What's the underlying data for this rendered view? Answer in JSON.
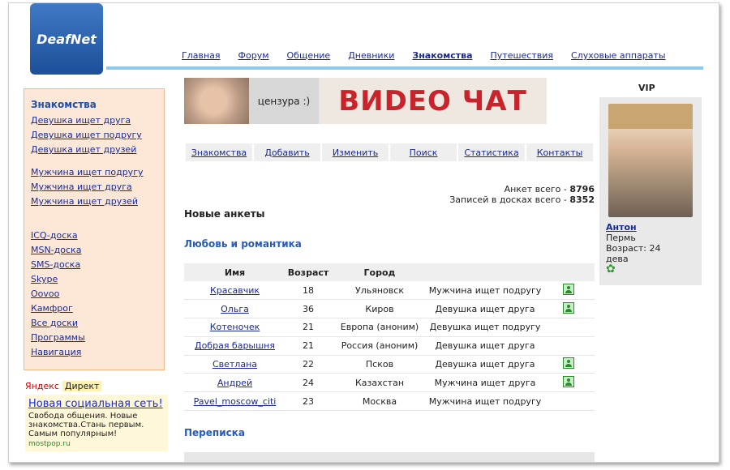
{
  "logo": "DeafNet",
  "topnav": [
    "Главная",
    "Форум",
    "Общение",
    "Дневники",
    "Знакомства",
    "Путешествия",
    "Слуховые аппараты"
  ],
  "topnav_active": "Знакомства",
  "sidebar": {
    "title": "Знакомства",
    "group1": [
      "Девушка ищет друга",
      "Девушка ищет подругу",
      "Девушка ищет друзей"
    ],
    "group2": [
      "Мужчина ищет подругу",
      "Мужчина ищет друга",
      "Мужчина ищет друзей"
    ],
    "group3": [
      "ICQ-доска",
      "MSN-доска",
      "SMS-доска",
      "Skype",
      "Oovoo",
      "Камфрог",
      "Все доски",
      "Программы",
      "Навигация"
    ]
  },
  "yandex": {
    "tab1": "Яндекс",
    "tab2": "Директ",
    "ad_title": "Новая социальная сеть!",
    "ad_body": "Свобода общения. Новые знакомства.Стань первым. Самым популярным!",
    "ad_url": "mostpop.ru"
  },
  "banner": {
    "censor": "цензура :)",
    "text": "ВИDЕО ЧАТ"
  },
  "subnav": [
    "Знакомства",
    "Добавить",
    "Изменить",
    "Поиск",
    "Статистика",
    "Контакты"
  ],
  "stats": {
    "profiles_label": "Анкет всего -",
    "profiles_value": "8796",
    "records_label": "Записей в досках всего -",
    "records_value": "8352"
  },
  "new_profiles_heading": "Новые анкеты",
  "love_heading": "Любовь и романтика",
  "correspondence_heading": "Переписка",
  "table": {
    "headers": [
      "Имя",
      "Возраст",
      "Город",
      ""
    ],
    "rows": [
      {
        "name": "Красавчик",
        "age": "18",
        "city": "Ульяновск",
        "type": "Мужчина ищет подругу",
        "photo": true
      },
      {
        "name": "Ольга",
        "age": "36",
        "city": "Киров",
        "type": "Девушка ищет друга",
        "photo": true
      },
      {
        "name": "Котеночек",
        "age": "21",
        "city": "Европа (аноним)",
        "type": "Девушка ищет подругу",
        "photo": false
      },
      {
        "name": "Добрая барышня",
        "age": "21",
        "city": "Россия (аноним)",
        "type": "Девушка ищет друга",
        "photo": false
      },
      {
        "name": "Светлана",
        "age": "22",
        "city": "Псков",
        "type": "Девушка ищет друга",
        "photo": true
      },
      {
        "name": "Андрей",
        "age": "24",
        "city": "Казахстан",
        "type": "Мужчина ищет друга",
        "photo": true
      },
      {
        "name": "Pavel_moscow_citi",
        "age": "23",
        "city": "Москва",
        "type": "Мужчина ищет подругу",
        "photo": false
      }
    ]
  },
  "vip": {
    "label": "VIP",
    "name": "Антон",
    "city": "Пермь",
    "age_label": "Возраст:",
    "age": "24",
    "sign": "дева"
  }
}
